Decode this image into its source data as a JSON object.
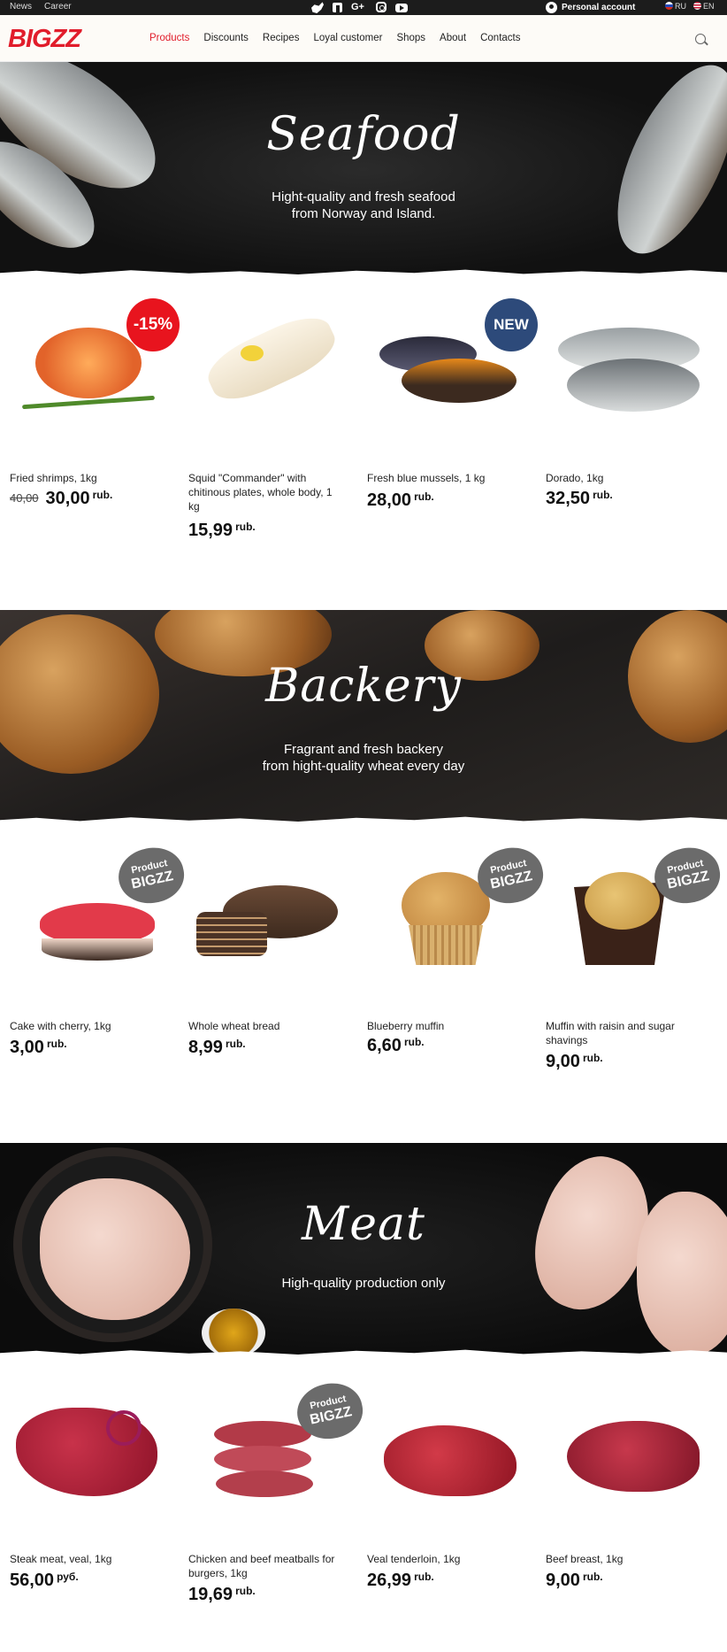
{
  "topbar": {
    "links": [
      "News",
      "Career"
    ],
    "social_icons": [
      "twitter-icon",
      "facebook-icon",
      "google-plus-icon",
      "instagram-icon",
      "youtube-icon"
    ],
    "account": "Personal account",
    "languages": [
      "RU",
      "EN"
    ]
  },
  "header": {
    "logo": "BIGZZ",
    "nav": [
      "Products",
      "Discounts",
      "Recipes",
      "Loyal customer",
      "Shops",
      "About",
      "Contacts"
    ],
    "active_nav": "Products"
  },
  "sections": {
    "seafood": {
      "title": "Seafood",
      "subtitle": "Hight-quality and fresh seafood\nfrom Norway and Island.",
      "products": [
        {
          "name": "Fried shrimps, 1kg",
          "old_price": "40,00",
          "price": "30,00",
          "currency": "rub.",
          "badge": "-15%"
        },
        {
          "name": "Squid \"Commander\" with chitinous plates, whole body, 1 kg",
          "price": "15,99",
          "currency": "rub."
        },
        {
          "name": "Fresh blue mussels, 1 kg",
          "price": "28,00",
          "currency": "rub.",
          "badge": "NEW"
        },
        {
          "name": "Dorado, 1kg",
          "price": "32,50",
          "currency": "rub."
        }
      ]
    },
    "bakery": {
      "title": "Backery",
      "subtitle": "Fragrant and fresh backery\nfrom hight-quality wheat every day",
      "products": [
        {
          "name": "Cake with cherry, 1kg",
          "price": "3,00",
          "currency": "rub.",
          "badge_top": "Product",
          "badge_bottom": "BIGZZ"
        },
        {
          "name": "Whole wheat bread",
          "price": "8,99",
          "currency": "rub."
        },
        {
          "name": "Blueberry muffin",
          "price": "6,60",
          "currency": "rub.",
          "badge_top": "Product",
          "badge_bottom": "BIGZZ"
        },
        {
          "name": "Muffin with raisin and sugar shavings",
          "price": "9,00",
          "currency": "rub.",
          "badge_top": "Product",
          "badge_bottom": "BIGZZ"
        }
      ]
    },
    "meat": {
      "title": "Meat",
      "subtitle": "High-quality production only",
      "products": [
        {
          "name": "Steak meat, veal, 1kg",
          "price": "56,00",
          "currency": "руб."
        },
        {
          "name": "Chicken and beef meatballs for burgers, 1kg",
          "price": "19,69",
          "currency": "rub.",
          "badge_top": "Product",
          "badge_bottom": "BIGZZ"
        },
        {
          "name": "Veal tenderloin, 1kg",
          "price": "26,99",
          "currency": "rub."
        },
        {
          "name": "Beef breast, 1kg",
          "price": "9,00",
          "currency": "rub."
        }
      ]
    }
  },
  "colors": {
    "brand_red": "#e11d2b",
    "sale_badge": "#e8141e",
    "new_badge": "#2d4a7a",
    "brand_badge": "#6b6b6b",
    "topbar": "#1c1c1c"
  }
}
